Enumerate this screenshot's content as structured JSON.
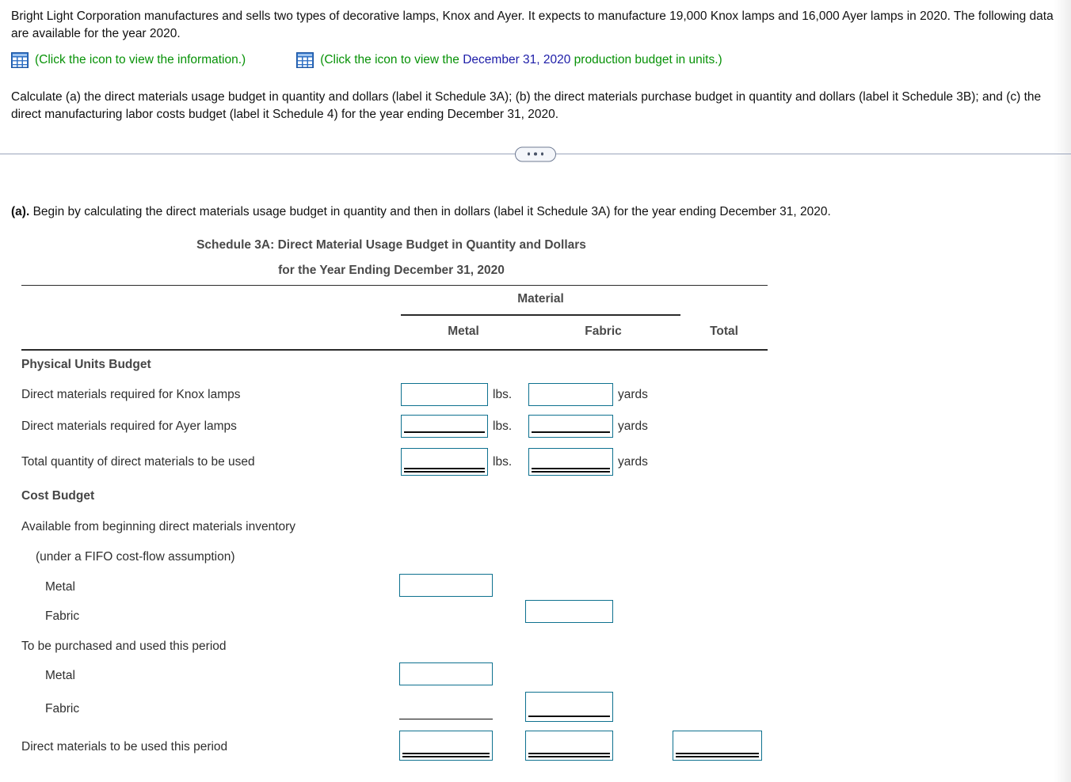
{
  "problem": {
    "paragraph1": "Bright Light Corporation manufactures and sells two types of decorative lamps, Knox and Ayer. It expects to manufacture 19,000 Knox lamps and 16,000 Ayer lamps in 2020. The following data are available for the year 2020.",
    "link1": {
      "icon": "spreadsheet-grid-icon",
      "text": "(Click the icon to view the information.)"
    },
    "link2": {
      "icon": "spreadsheet-grid-icon",
      "text_before": "(Click the icon to view the ",
      "highlight": "December 31, 2020",
      "text_after": " production budget in units.)"
    },
    "paragraph2": "Calculate (a) the direct materials usage budget in quantity and dollars (label it Schedule 3A); (b) the direct materials purchase budget in quantity and dollars (label it Schedule 3B); and (c) the direct manufacturing labor costs budget (label it Schedule 4) for the year ending December 31, 2020."
  },
  "divider": {
    "dots_label": "..."
  },
  "answer": {
    "part_label": "(a).",
    "instruction": "Begin by calculating the direct materials usage budget in quantity and then in dollars (label it Schedule 3A) for the year ending December 31, 2020."
  },
  "schedule": {
    "title_line1": "Schedule 3A: Direct Material Usage Budget in Quantity and Dollars",
    "title_line2": "for the Year Ending December 31, 2020",
    "group_header": "Material",
    "columns": [
      "Metal",
      "Fabric",
      "Total"
    ],
    "units": {
      "metal": "lbs.",
      "fabric": "yards"
    },
    "sections": [
      {
        "heading": "Physical Units Budget",
        "rows": [
          {
            "label": "Direct materials required for Knox lamps",
            "metal_value": "",
            "fabric_value": ""
          },
          {
            "label": "Direct materials required for Ayer lamps",
            "metal_value": "",
            "fabric_value": ""
          },
          {
            "label": "Total quantity of direct materials to be used",
            "metal_value": "",
            "fabric_value": ""
          }
        ]
      },
      {
        "heading": "Cost Budget",
        "rows": [
          {
            "label": "Available from beginning direct materials inventory"
          },
          {
            "label": "(under a FIFO cost-flow assumption)"
          },
          {
            "label": "Metal",
            "metal_value": ""
          },
          {
            "label": "Fabric",
            "fabric_value": ""
          },
          {
            "label": "To be purchased and used this period"
          },
          {
            "label": "Metal",
            "metal_value": ""
          },
          {
            "label": "Fabric",
            "fabric_value": ""
          },
          {
            "label": "Direct materials to be used this period",
            "metal_value": "",
            "fabric_value": "",
            "total_value": ""
          }
        ]
      }
    ]
  },
  "colors": {
    "link_green": "#079207",
    "link_blue": "#1c1ca8",
    "input_border": "#0e718f",
    "header_text": "#4a4a4a",
    "rule": "#2b2b2b"
  }
}
